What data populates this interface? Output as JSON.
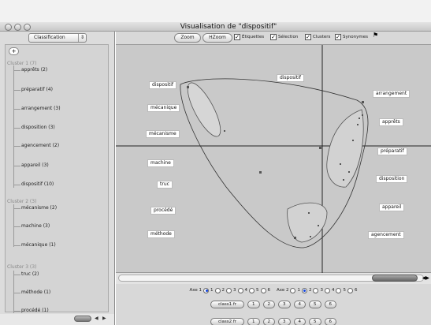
{
  "window": {
    "title": "Visualisation de \"dispositif\""
  },
  "sidebar": {
    "selector_value": "Classification",
    "selector_arrow": "⇕",
    "add_label": "+",
    "clusters": [
      {
        "label": "Cluster 1  (7)",
        "items": [
          "apprêts (2)",
          "préparatif (4)",
          "arrangement (3)",
          "disposition (3)",
          "agencement (2)",
          "appareil (3)",
          "dispositif (10)"
        ]
      },
      {
        "label": "Cluster 2  (3)",
        "items": [
          "mécanisme (2)",
          "machine (3)",
          "mécanique (1)"
        ]
      },
      {
        "label": "Cluster 3  (3)",
        "items": [
          "truc (2)",
          "méthode (1)",
          "procédé (1)"
        ]
      }
    ]
  },
  "toolbar": {
    "zoom_label": "Zoom",
    "hzoom_label": "HZoom",
    "checkboxes": [
      {
        "label": "Étiquettes",
        "checked": true
      },
      {
        "label": "Sélection",
        "checked": true
      },
      {
        "label": "Clusters",
        "checked": true
      },
      {
        "label": "Synonymes",
        "checked": true
      }
    ]
  },
  "plot": {
    "labels": [
      "dispositif",
      "dispositif",
      "mécanique",
      "mécanisme",
      "machine",
      "truc",
      "procédé",
      "méthode",
      "arrangement",
      "apprêts",
      "préparatif",
      "disposition",
      "appareil",
      "agencement"
    ]
  },
  "axes": {
    "axe1_label": "Axe 1",
    "axe2_label": "Axe 2",
    "options": [
      "1",
      "2",
      "3",
      "4",
      "5",
      "6"
    ],
    "axe1_selected": "1",
    "axe2_selected": "2"
  },
  "classes": {
    "row1": {
      "label": "class1 fr",
      "buttons": [
        "1",
        "2",
        "3",
        "4",
        "5",
        "6"
      ]
    },
    "row2": {
      "label": "class2 fr",
      "buttons": [
        "1",
        "2",
        "3",
        "4",
        "5",
        "6"
      ]
    }
  },
  "colors": {
    "check": "#000000",
    "radio_selected": "#1144dd"
  }
}
